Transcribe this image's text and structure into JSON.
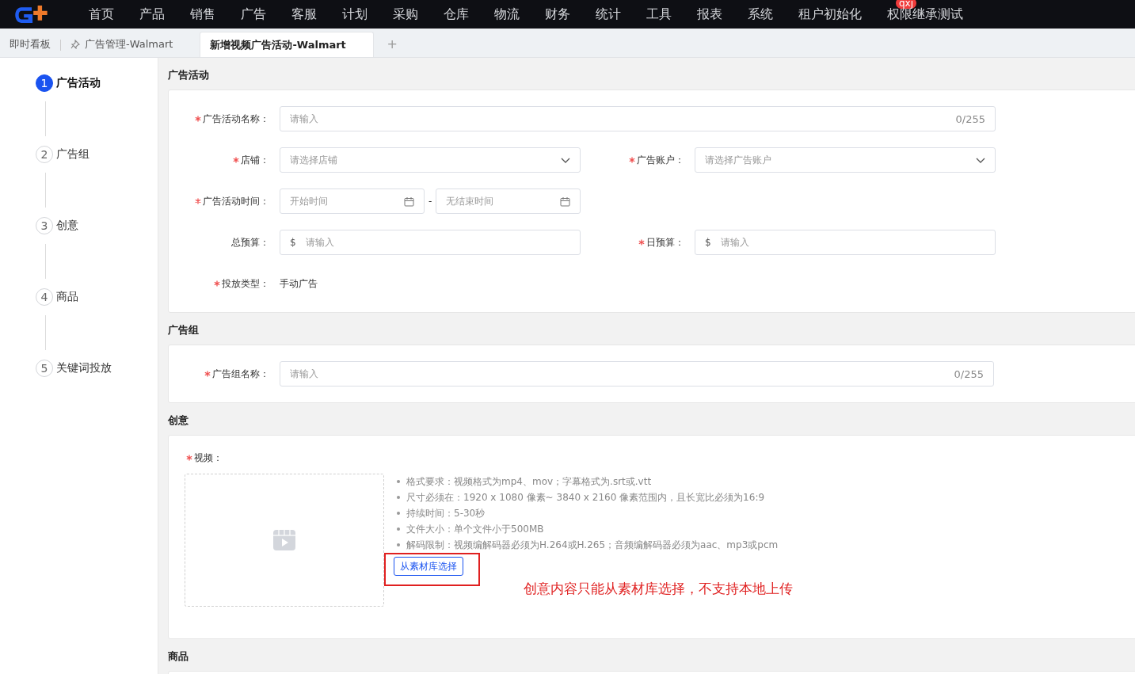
{
  "nav": {
    "items": [
      "首页",
      "产品",
      "销售",
      "广告",
      "客服",
      "计划",
      "采购",
      "仓库",
      "物流",
      "财务",
      "统计",
      "工具",
      "报表",
      "系统",
      "租户初始化",
      "权限继承测试"
    ],
    "badge": "qxj"
  },
  "tabs": [
    {
      "label": "即时看板",
      "selected": false,
      "pinned": false
    },
    {
      "label": "广告管理-Walmart",
      "selected": false,
      "pinned": true
    },
    {
      "label": "新增视频广告活动-Walmart",
      "selected": true,
      "pinned": false
    }
  ],
  "tab_add": "+",
  "steps": [
    {
      "number": "1",
      "label": "广告活动",
      "selected": true
    },
    {
      "number": "2",
      "label": "广告组",
      "selected": false
    },
    {
      "number": "3",
      "label": "创意",
      "selected": false
    },
    {
      "number": "4",
      "label": "商品",
      "selected": false
    },
    {
      "number": "5",
      "label": "关键词投放",
      "selected": false
    }
  ],
  "sections": [
    {
      "title": "广告活动",
      "kind": "form",
      "rows": [
        [
          {
            "kind": "text",
            "label": "广告活动名称：",
            "required": true,
            "placeholder": "请输入",
            "counter": "0/255"
          }
        ],
        [
          {
            "kind": "select",
            "label": "店铺：",
            "required": true,
            "placeholder": "请选择店铺"
          },
          {
            "kind": "select",
            "label": "广告账户：",
            "required": true,
            "placeholder": "请选择广告账户"
          }
        ],
        [
          {
            "kind": "daterange",
            "label": "广告活动时间：",
            "required": true,
            "start_placeholder": "开始时间",
            "separator": "-",
            "end_placeholder": "无结束时间"
          }
        ],
        [
          {
            "kind": "money",
            "label": "总预算：",
            "required": false,
            "prefix": "$",
            "placeholder": "请输入"
          },
          {
            "kind": "money",
            "label": "日预算：",
            "required": true,
            "prefix": "$",
            "placeholder": "请输入"
          }
        ],
        [
          {
            "kind": "static",
            "label": "投放类型：",
            "required": true,
            "value": "手动广告"
          }
        ]
      ]
    },
    {
      "title": "广告组",
      "kind": "form",
      "rows": [
        [
          {
            "kind": "text",
            "label": "广告组名称：",
            "required": true,
            "placeholder": "请输入",
            "counter": "0/255"
          }
        ]
      ]
    },
    {
      "title": "创意",
      "kind": "upload",
      "label": "视频：",
      "required": true,
      "requirements": [
        "格式要求：视频格式为mp4、mov；字幕格式为.srt或.vtt",
        "尺寸必须在：1920 x 1080 像素~ 3840 x 2160 像素范围内，且长宽比必须为16:9",
        "持续时间：5-30秒",
        "文件大小：单个文件小于500MB",
        "解码限制：视频编解码器必须为H.264或H.265；音频编解码器必须为aac、mp3或pcm"
      ],
      "button": "从素材库选择",
      "annotation": "创意内容只能从素材库选择，不支持本地上传"
    },
    {
      "title": "商品",
      "kind": "empty"
    }
  ]
}
